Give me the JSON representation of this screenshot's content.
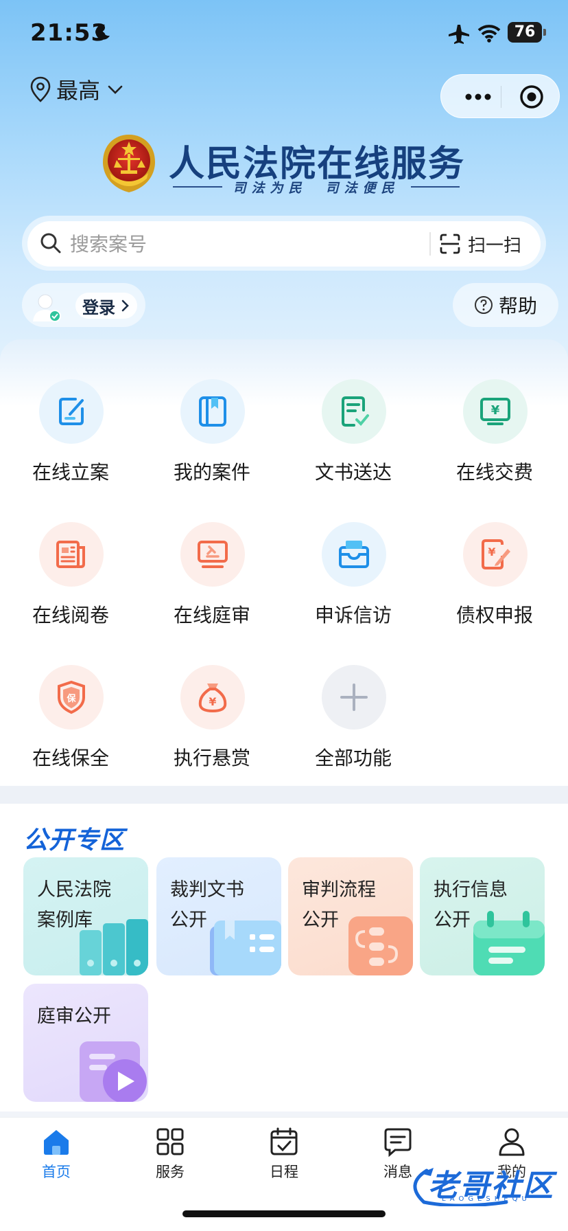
{
  "status_bar": {
    "time": "21:53",
    "battery": "76"
  },
  "location": {
    "label": "最高"
  },
  "header": {
    "title": "人民法院在线服务",
    "slogan": "司法为民　司法便民"
  },
  "search": {
    "placeholder": "搜索案号",
    "scan_label": "扫一扫"
  },
  "user": {
    "login_label": "登录",
    "help_label": "帮助"
  },
  "services": [
    {
      "label": "在线立案",
      "icon": "edit-document-icon",
      "color": "#1e8fe8"
    },
    {
      "label": "我的案件",
      "icon": "book-icon",
      "color": "#1e8fe8"
    },
    {
      "label": "文书送达",
      "icon": "document-check-icon",
      "color": "#1aa37a"
    },
    {
      "label": "在线交费",
      "icon": "payment-screen-icon",
      "color": "#1aa37a"
    },
    {
      "label": "在线阅卷",
      "icon": "newspaper-icon",
      "color": "#f26b4a"
    },
    {
      "label": "在线庭审",
      "icon": "gavel-screen-icon",
      "color": "#f26b4a"
    },
    {
      "label": "申诉信访",
      "icon": "inbox-icon",
      "color": "#1e8fe8"
    },
    {
      "label": "债权申报",
      "icon": "claim-edit-icon",
      "color": "#f26b4a"
    },
    {
      "label": "在线保全",
      "icon": "shield-icon",
      "color": "#f26b4a"
    },
    {
      "label": "执行悬赏",
      "icon": "money-bag-icon",
      "color": "#f26b4a"
    },
    {
      "label": "全部功能",
      "icon": "plus-icon",
      "color": "#aab1bf"
    }
  ],
  "public_section": {
    "title": "公开专区",
    "cards": [
      {
        "label": "人民法院\n案例库",
        "icon": "binders-icon"
      },
      {
        "label": "裁判文书\n公开",
        "icon": "open-book-icon"
      },
      {
        "label": "审判流程\n公开",
        "icon": "flow-icon"
      },
      {
        "label": "执行信息\n公开",
        "icon": "calendar-icon"
      },
      {
        "label": "庭审公开",
        "icon": "video-play-icon"
      }
    ]
  },
  "tab_bar": {
    "active": "首页",
    "tabs": [
      {
        "label": "首页",
        "icon": "home-icon"
      },
      {
        "label": "服务",
        "icon": "grid-icon"
      },
      {
        "label": "日程",
        "icon": "calendar-check-icon"
      },
      {
        "label": "消息",
        "icon": "message-icon"
      },
      {
        "label": "我的",
        "icon": "user-icon"
      }
    ]
  },
  "watermark": {
    "text": "老哥社区",
    "subtext": "LAOGESHEQU"
  }
}
